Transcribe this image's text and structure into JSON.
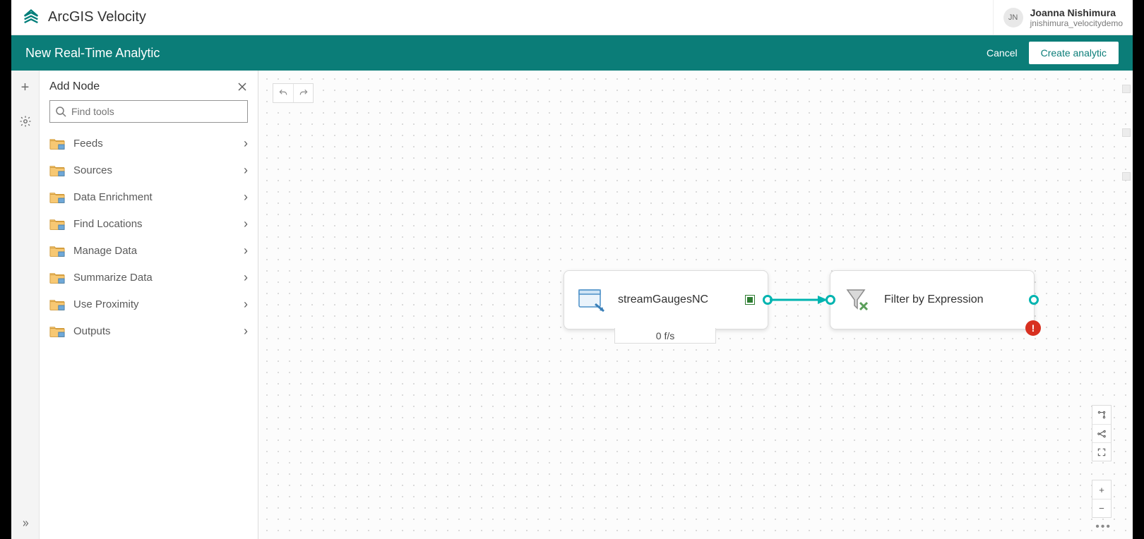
{
  "header": {
    "app_title": "ArcGIS Velocity",
    "user_initials": "JN",
    "user_name": "Joanna Nishimura",
    "user_subtext": "jnishimura_velocitydemo"
  },
  "subheader": {
    "title": "New Real-Time Analytic",
    "cancel_label": "Cancel",
    "create_label": "Create analytic"
  },
  "sidepanel": {
    "title": "Add Node",
    "search_placeholder": "Find tools",
    "categories": [
      {
        "label": "Feeds"
      },
      {
        "label": "Sources"
      },
      {
        "label": "Data Enrichment"
      },
      {
        "label": "Find Locations"
      },
      {
        "label": "Manage Data"
      },
      {
        "label": "Summarize Data"
      },
      {
        "label": "Use Proximity"
      },
      {
        "label": "Outputs"
      }
    ]
  },
  "canvas": {
    "node1_label": "streamGaugesNC",
    "node1_rate": "0 f/s",
    "node2_label": "Filter by Expression",
    "warn_symbol": "!"
  },
  "icons": {
    "plus": "+",
    "minus": "−",
    "chevron": "›"
  },
  "colors": {
    "teal": "#0b7d78",
    "port": "#00b4b0",
    "warn": "#d83020"
  }
}
